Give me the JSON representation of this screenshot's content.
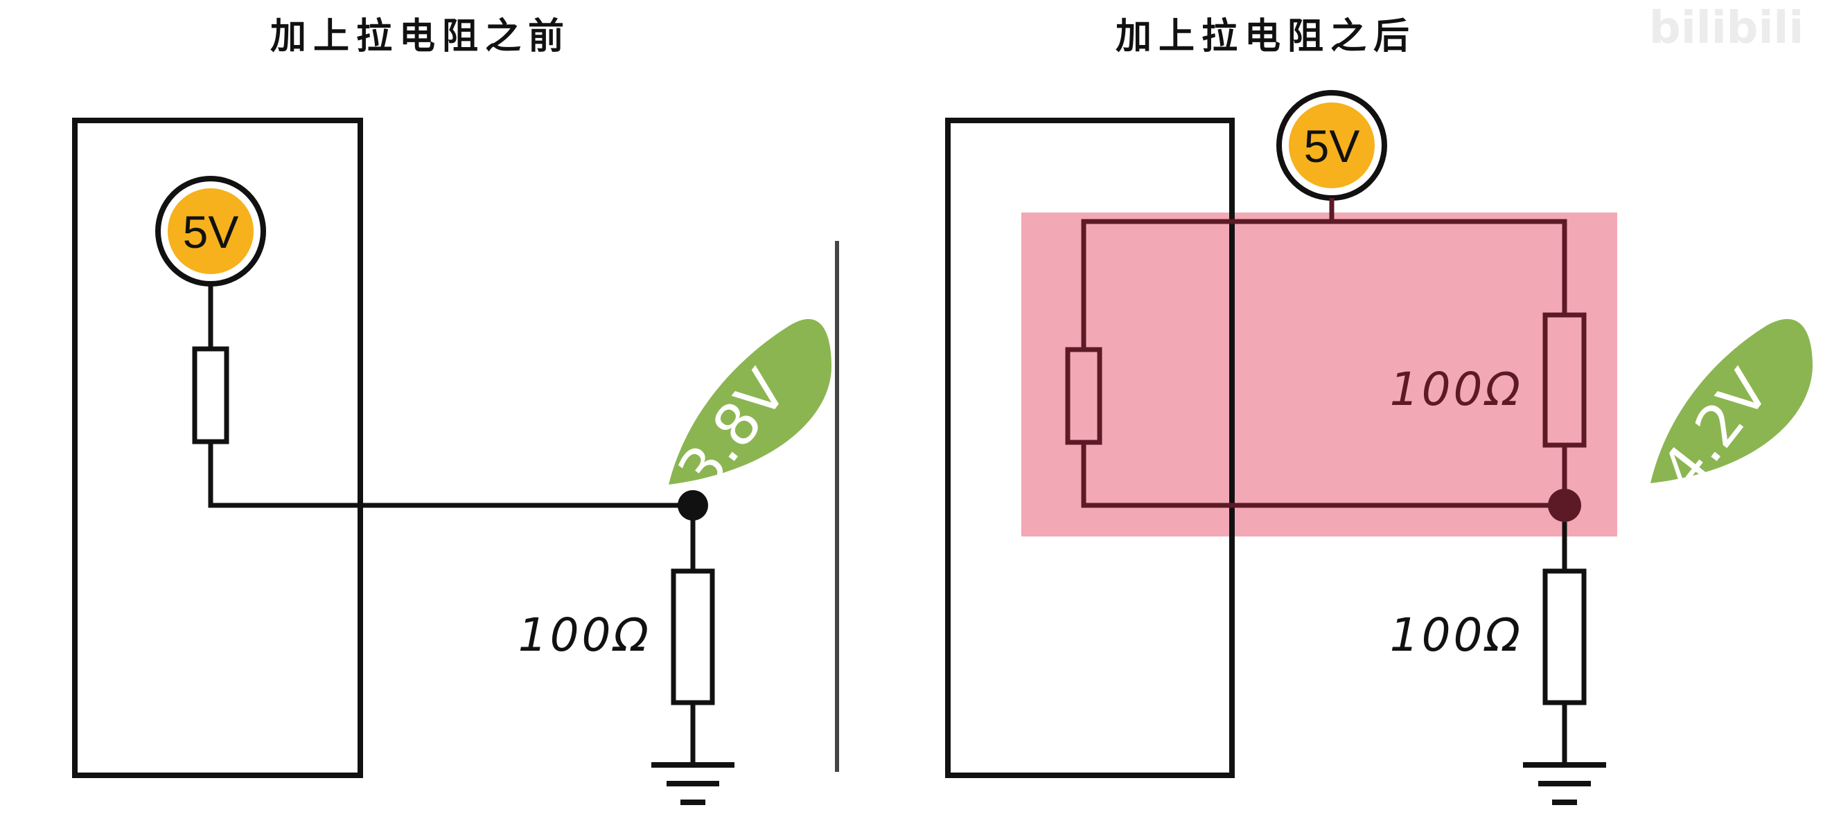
{
  "panels": {
    "left": {
      "title": "加上拉电阻之前",
      "source_label": "5V",
      "resistor_label": "100Ω",
      "voltage_tag": "3.8V"
    },
    "right": {
      "title": "加上拉电阻之后",
      "source_label": "5V",
      "resistor_top_label": "100Ω",
      "resistor_bottom_label": "100Ω",
      "voltage_tag": "4.2V"
    }
  },
  "watermark": "bilibili",
  "colors": {
    "source_fill": "#f6b11c",
    "tag_fill": "#8bb551",
    "highlight_fill": "#f2a3b1",
    "highlight_wire": "#5c1a26"
  },
  "icons": [
    "ground-icon",
    "resistor-icon",
    "voltage-source-icon"
  ]
}
